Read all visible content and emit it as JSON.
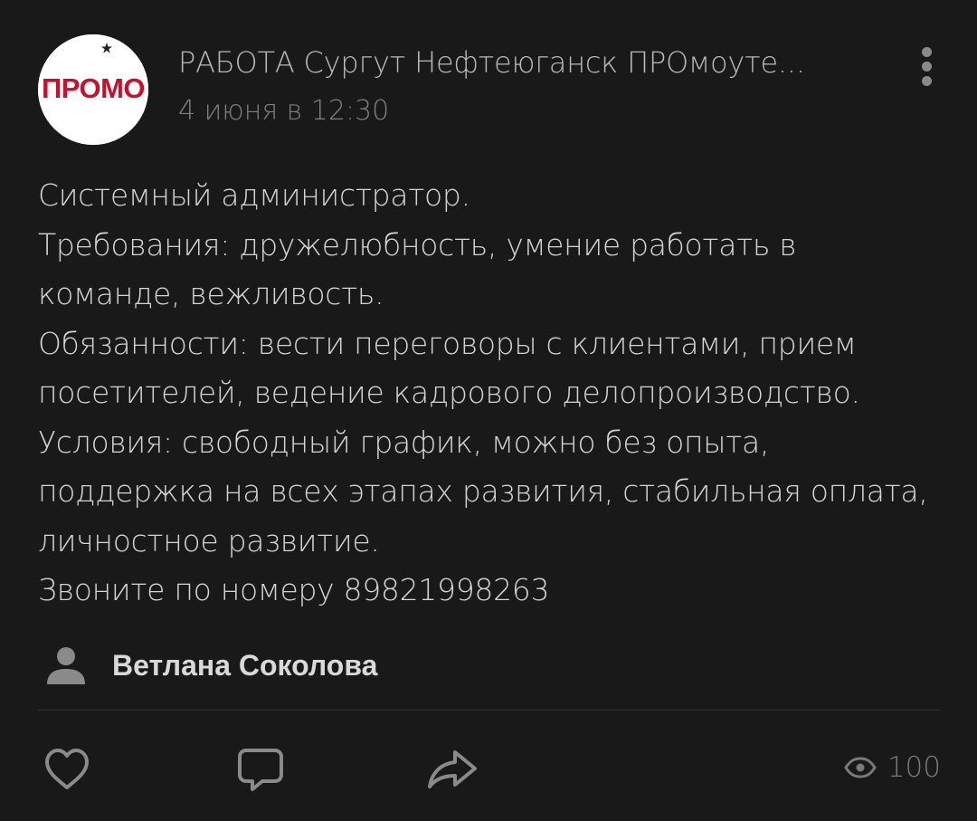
{
  "header": {
    "avatar_text": "ПРОМО",
    "group_name": "РАБОТА Сургут Нефтеюганск ПРОмоуте...",
    "date": "4 июня в 12:30",
    "more_icon": "more-vertical-icon"
  },
  "post": {
    "lines": [
      "Системный администратор.",
      "Требования: дружелюбность, умение работать в",
      "команде, вежливость.",
      "Обязанности: вести переговоры с клиентами, прием",
      "посетителей, ведение кадрового делопроизводство.",
      "Условия: свободный график, можно без опыта,",
      "поддержка на всех этапах развития, стабильная оплата,",
      "личностное развитие.",
      "Звоните по номеру 89821998263"
    ]
  },
  "signer": {
    "name": "Ветлана Соколова",
    "icon": "user-icon"
  },
  "actions": {
    "like_icon": "heart-icon",
    "comment_icon": "comment-icon",
    "share_icon": "share-icon",
    "views_icon": "eye-icon",
    "views_count": "100"
  },
  "colors": {
    "background": "#191919",
    "text": "#d4d4d4",
    "secondary_text": "#7e7e7e",
    "icon": "#8a8a8a",
    "logo_red": "#c8102e"
  }
}
